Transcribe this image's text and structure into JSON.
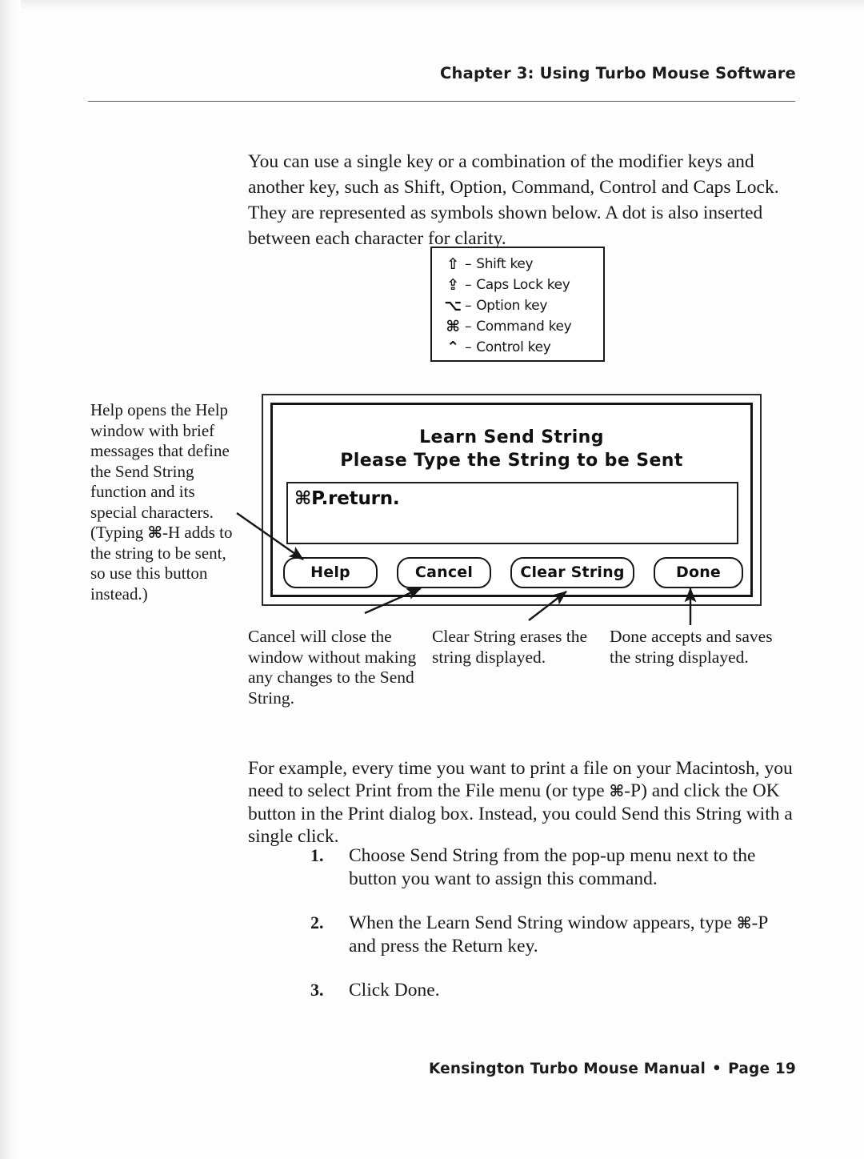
{
  "header": {
    "running_head": "Chapter 3: Using Turbo Mouse Software"
  },
  "intro_paragraph": "You can use a single key or a combination of the modifier keys and another key, such as Shift, Option, Command, Control and Caps Lock. They are represented as symbols shown below. A dot is also inserted between each character for clarity.",
  "key_legend": {
    "rows": [
      {
        "glyph": "⇧",
        "glyph_name": "shift-key-glyph",
        "dash": "–",
        "label": "Shift key"
      },
      {
        "glyph": "⇪",
        "glyph_name": "caps-lock-key-glyph",
        "dash": "–",
        "label": "Caps Lock key"
      },
      {
        "glyph": "⌥",
        "glyph_name": "option-key-glyph",
        "dash": "–",
        "label": "Option key"
      },
      {
        "glyph": "⌘",
        "glyph_name": "command-key-glyph",
        "dash": "–",
        "label": "Command key"
      },
      {
        "glyph": "⌃",
        "glyph_name": "control-key-glyph",
        "dash": "–",
        "label": "Control key"
      }
    ]
  },
  "dialog": {
    "title": "Learn Send String",
    "subtitle": "Please Type the String to be Sent",
    "field_value": "⌘P.return.",
    "field_placeholder": "",
    "buttons": {
      "help": "Help",
      "cancel": "Cancel",
      "clear_string": "Clear String",
      "done": "Done"
    }
  },
  "margin_note": {
    "part1": "Help opens the Help window with brief messages that define the Send String function and its special characters. (Typing ",
    "cmd_glyph": "⌘",
    "part2": "-H adds to the string to be sent, so use this button instead.)"
  },
  "captions": {
    "cancel": "Cancel will close the window without making any changes to the Send String.",
    "clear_string": "Clear String erases the string displayed.",
    "done": "Done accepts and saves the string displayed."
  },
  "example_paragraph": {
    "part1": "For example, every time you want to print a file on your Macintosh, you need to select Print from the File menu (or type ",
    "cmd_glyph": "⌘",
    "part2": "-P) and click the OK button in the Print dialog box. Instead, you could Send this String with a single click."
  },
  "steps": [
    {
      "number": "1.",
      "text": "Choose Send String from the pop-up menu next to the button you want to assign this command."
    },
    {
      "number": "2.",
      "text_part1": "When the Learn Send String window appears, type ",
      "cmd_glyph": "⌘",
      "text_part2": "-P and press the Return key."
    },
    {
      "number": "3.",
      "text": "Click Done."
    }
  ],
  "footer": {
    "title": "Kensington Turbo Mouse Manual",
    "separator": "•",
    "page": "Page 19"
  },
  "colors": {
    "ink": "#1a1a1a",
    "rule": "#555555",
    "paper": "#fdfdfd"
  }
}
